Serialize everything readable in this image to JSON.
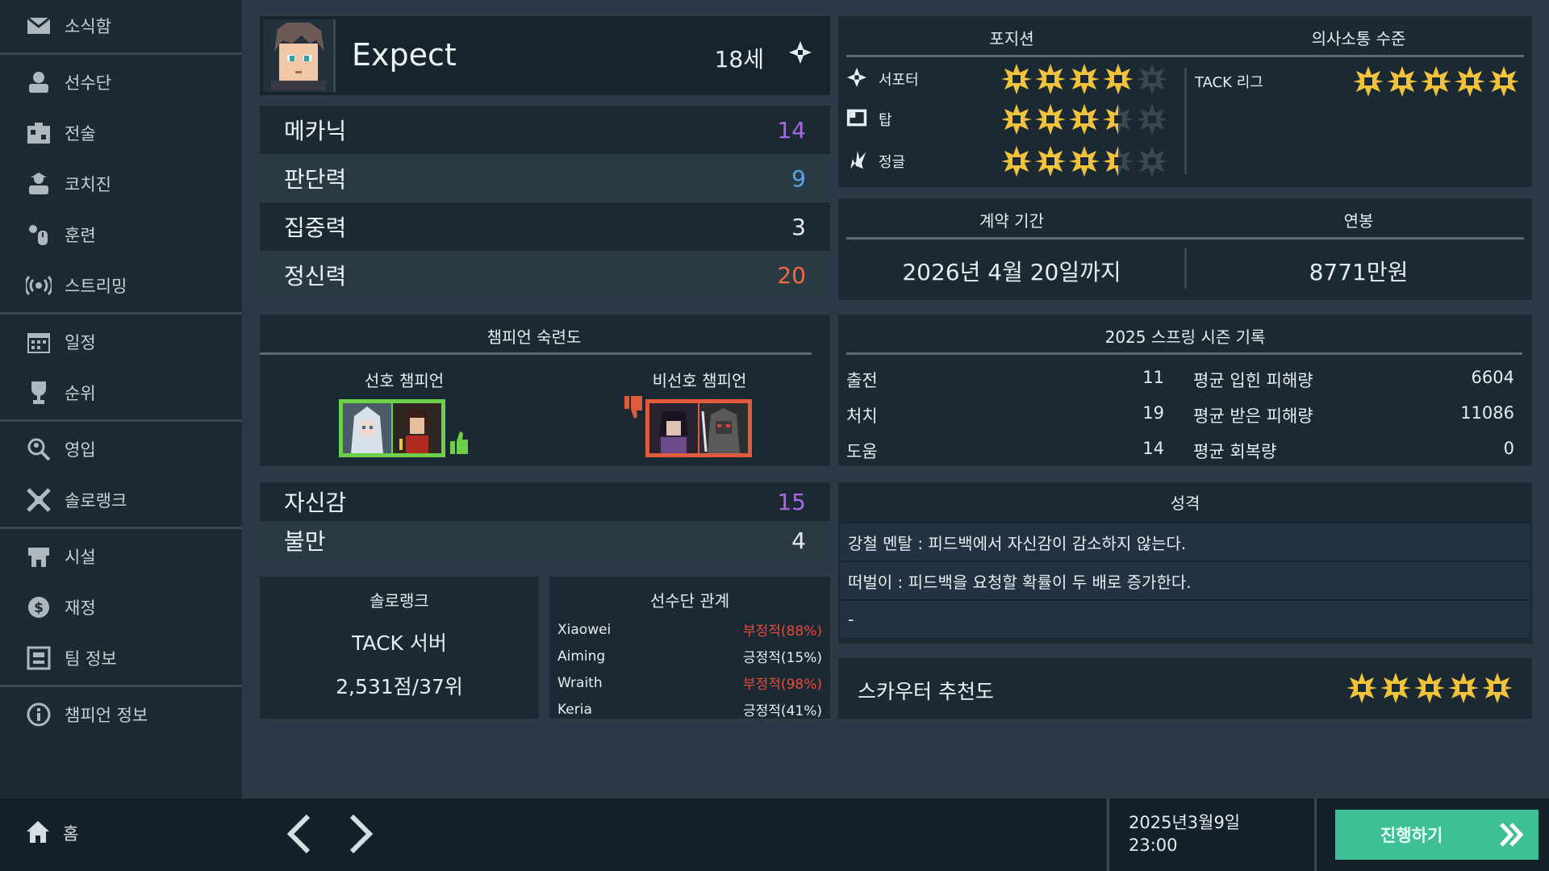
{
  "sidebar": {
    "items": [
      {
        "label": "소식함",
        "icon": "mail-icon"
      },
      {
        "label": "선수단",
        "icon": "players-icon"
      },
      {
        "label": "전술",
        "icon": "tactics-icon"
      },
      {
        "label": "코치진",
        "icon": "coaches-icon"
      },
      {
        "label": "훈련",
        "icon": "training-icon"
      },
      {
        "label": "스트리밍",
        "icon": "streaming-icon"
      },
      {
        "label": "일정",
        "icon": "calendar-icon"
      },
      {
        "label": "순위",
        "icon": "trophy-icon"
      },
      {
        "label": "영입",
        "icon": "recruit-icon"
      },
      {
        "label": "솔로랭크",
        "icon": "solorank-icon"
      },
      {
        "label": "시설",
        "icon": "facility-icon"
      },
      {
        "label": "재정",
        "icon": "finance-icon"
      },
      {
        "label": "팀 정보",
        "icon": "team-info-icon"
      },
      {
        "label": "챔피언 정보",
        "icon": "champion-info-icon"
      }
    ]
  },
  "bottom": {
    "home_label": "홈",
    "date": "2025년3월9일",
    "time": "23:00",
    "proceed_label": "진행하기"
  },
  "player": {
    "name": "Expect",
    "age": "18세",
    "stats": [
      {
        "name": "메카닉",
        "value": "14",
        "color": "#a66be3"
      },
      {
        "name": "판단력",
        "value": "9",
        "color": "#5fa3e8"
      },
      {
        "name": "집중력",
        "value": "3",
        "color": "#e6ecef"
      },
      {
        "name": "정신력",
        "value": "20",
        "color": "#f0693a"
      }
    ],
    "confidence": {
      "name": "자신감",
      "value": "15",
      "color": "#a66be3"
    },
    "dissatisfaction": {
      "name": "불만",
      "value": "4",
      "color": "#e6ecef"
    }
  },
  "mastery": {
    "title": "챔피언 숙련도",
    "preferred_label": "선호 챔피언",
    "non_preferred_label": "비선호 챔피언",
    "preferred_color": "#6ed04a",
    "non_preferred_color": "#e05a3e"
  },
  "solorank": {
    "title": "솔로랭크",
    "server": "TACK 서버",
    "score": "2,531점/37위"
  },
  "relations": {
    "title": "선수단 관계",
    "rows": [
      {
        "name": "Xiaowei",
        "value": "부정적(88%)",
        "color": "#e84a3c"
      },
      {
        "name": "Aiming",
        "value": "긍정적(15%)",
        "color": "#e6ecef"
      },
      {
        "name": "Wraith",
        "value": "부정적(98%)",
        "color": "#e84a3c"
      },
      {
        "name": "Keria",
        "value": "긍정적(41%)",
        "color": "#e6ecef"
      }
    ]
  },
  "positions": {
    "title": "포지션",
    "comm_title": "의사소통 수준",
    "rows": [
      {
        "name": "서포터",
        "icon": "support-icon",
        "stars": 4
      },
      {
        "name": "탑",
        "icon": "top-icon",
        "stars": 3.5
      },
      {
        "name": "정글",
        "icon": "jungle-icon",
        "stars": 3.5
      }
    ],
    "comm": {
      "name": "TACK 리그",
      "stars": 5
    }
  },
  "contract": {
    "term_title": "계약 기간",
    "salary_title": "연봉",
    "term": "2026년 4월 20일까지",
    "salary": "8771만원"
  },
  "season": {
    "title": "2025 스프링 시즌 기록",
    "left": [
      {
        "label": "출전",
        "value": "11"
      },
      {
        "label": "처치",
        "value": "19"
      },
      {
        "label": "도움",
        "value": "14"
      }
    ],
    "right": [
      {
        "label": "평균 입힌 피해량",
        "value": "6604"
      },
      {
        "label": "평균 받은 피해량",
        "value": "11086"
      },
      {
        "label": "평균 회복량",
        "value": "0"
      }
    ]
  },
  "personality": {
    "title": "성격",
    "traits": [
      "강철 멘탈 : 피드백에서 자신감이 감소하지 않는다.",
      "떠벌이 : 피드백을 요청할 확률이 두 배로 증가한다.",
      "-"
    ]
  },
  "scouter": {
    "label": "스카우터 추천도",
    "stars": 5
  },
  "colors": {
    "star": "#f2c23a",
    "star_empty": "#3a4852",
    "proceed": "#3fbf95"
  }
}
